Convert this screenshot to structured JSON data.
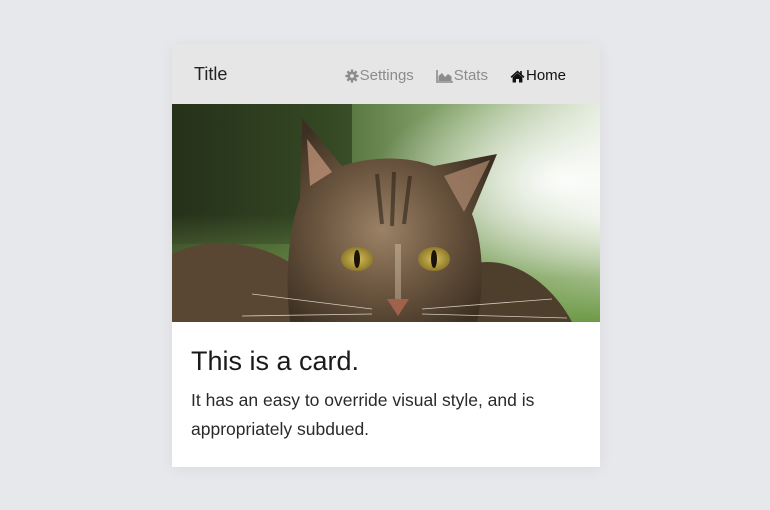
{
  "card": {
    "title": "Title",
    "nav": [
      {
        "label": "Settings",
        "icon": "gear-icon",
        "active": false
      },
      {
        "label": "Stats",
        "icon": "area-chart-icon",
        "active": false
      },
      {
        "label": "Home",
        "icon": "home-icon",
        "active": true
      }
    ],
    "heading": "This is a card.",
    "text": "It has an easy to override visual style, and is appropriately subdued."
  },
  "colors": {
    "background": "#e7e8eb",
    "header": "#e6e6e6",
    "nav_inactive": "#8c8c8c",
    "nav_active": "#111111"
  }
}
